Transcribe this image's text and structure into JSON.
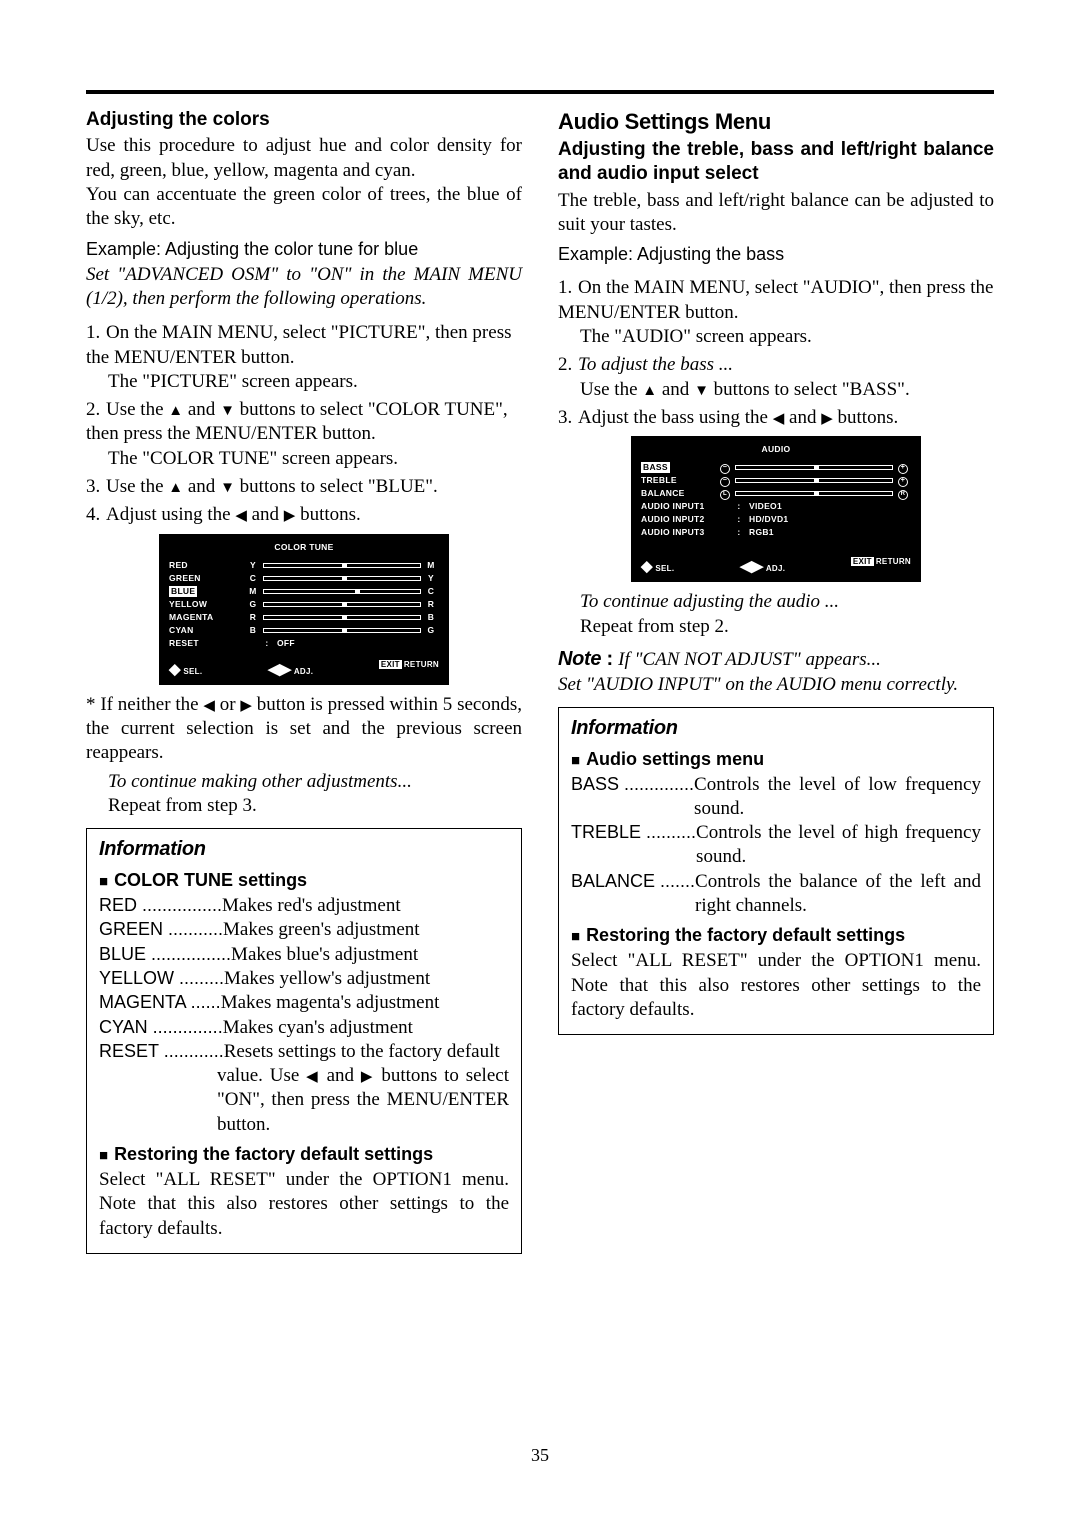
{
  "pagenum": "35",
  "left": {
    "h_colors": "Adjusting the colors",
    "p1": "Use this procedure to adjust hue and color density for red, green, blue, yellow, magenta and cyan.",
    "p2": "You can accentuate the green color of trees, the blue of the sky, etc.",
    "example": "Example: Adjusting the color tune for blue",
    "setline": "Set \"ADVANCED OSM\" to \"ON\" in the MAIN MENU (1/2), then perform the following operations.",
    "s1a": "On the MAIN MENU, select \"PICTURE\", then press the MENU/ENTER button.",
    "s1b": "The \"PICTURE\" screen appears.",
    "s2a": "Use the ",
    "s2b": " and ",
    "s2c": " buttons to select \"COLOR TUNE\", then press the MENU/ENTER button.",
    "s2d": "The \"COLOR TUNE\" screen appears.",
    "s3a": "Use the ",
    "s3b": " and ",
    "s3c": " buttons to select \"BLUE\".",
    "s4a": "Adjust using the ",
    "s4b": " and ",
    "s4c": " buttons.",
    "osm": {
      "title": "COLOR TUNE",
      "rows": [
        {
          "label": "RED",
          "l": "Y",
          "r": "M",
          "sel": false,
          "mark": 50
        },
        {
          "label": "GREEN",
          "l": "C",
          "r": "Y",
          "sel": false,
          "mark": 50
        },
        {
          "label": "BLUE",
          "l": "M",
          "r": "C",
          "sel": true,
          "mark": 58
        },
        {
          "label": "YELLOW",
          "l": "G",
          "r": "R",
          "sel": false,
          "mark": 50
        },
        {
          "label": "MAGENTA",
          "l": "R",
          "r": "B",
          "sel": false,
          "mark": 50
        },
        {
          "label": "CYAN",
          "l": "B",
          "r": "G",
          "sel": false,
          "mark": 50
        }
      ],
      "reset_label": "RESET",
      "reset_value": "OFF",
      "foot_sel": "SEL.",
      "foot_adj": "ADJ.",
      "foot_exit": "EXIT",
      "foot_return": "RETURN"
    },
    "star_note": "If neither the ",
    "star_note2": " or ",
    "star_note3": " button is pressed within 5 seconds, the current selection is set and the previous screen reappears.",
    "cont1": "To continue making other adjustments...",
    "cont2": "Repeat from step 3.",
    "info": {
      "title": "Information",
      "sub1": "COLOR TUNE settings",
      "defs": [
        {
          "term": "RED ................",
          "desc": "Makes red's adjustment"
        },
        {
          "term": "GREEN ...........",
          "desc": "Makes green's adjustment"
        },
        {
          "term": "BLUE ................",
          "desc": "Makes blue's adjustment"
        },
        {
          "term": "YELLOW .........",
          "desc": "Makes yellow's adjustment"
        },
        {
          "term": "MAGENTA ......",
          "desc": "Makes magenta's adjustment"
        },
        {
          "term": "CYAN ..............",
          "desc": "Makes cyan's adjustment"
        },
        {
          "term": "RESET ............",
          "desc": "Resets settings to the factory default value. Use "
        }
      ],
      "reset_tail1": " and ",
      "reset_tail2": " buttons to select \"ON\", then press the MENU/ENTER button.",
      "sub2": "Restoring the factory default settings",
      "restore": "Select \"ALL RESET\" under the OPTION1 menu. Note that this also restores other settings to the factory defaults."
    }
  },
  "right": {
    "title": "Audio Settings Menu",
    "h1": "Adjusting the treble, bass and left/right balance and audio input select",
    "p1": "The treble, bass and left/right balance can be adjusted to suit your tastes.",
    "example": "Example: Adjusting the bass",
    "s1a": "On the MAIN MENU, select \"AUDIO\", then press the MENU/ENTER button.",
    "s1b": "The \"AUDIO\" screen appears.",
    "s2a_it": "To adjust the bass ...",
    "s2b": "Use the ",
    "s2c": " and ",
    "s2d": " buttons to select \"BASS\".",
    "s3a": "Adjust the bass using the ",
    "s3b": " and ",
    "s3c": " buttons.",
    "osm": {
      "title": "AUDIO",
      "bars": [
        {
          "label": "BASS",
          "l": "−",
          "r": "+",
          "sel": true,
          "mark": 50
        },
        {
          "label": "TREBLE",
          "l": "−",
          "r": "+",
          "sel": false,
          "mark": 50
        },
        {
          "label": "BALANCE",
          "l": "L",
          "r": "R",
          "sel": false,
          "mark": 50
        }
      ],
      "vals": [
        {
          "label": "AUDIO INPUT1",
          "val": "VIDEO1"
        },
        {
          "label": "AUDIO INPUT2",
          "val": "HD/DVD1"
        },
        {
          "label": "AUDIO INPUT3",
          "val": "RGB1"
        }
      ],
      "foot_sel": "SEL.",
      "foot_adj": "ADJ.",
      "foot_exit": "EXIT",
      "foot_return": "RETURN"
    },
    "cont1": "To continue adjusting the audio ...",
    "cont2": "Repeat from step 2.",
    "note_label": "Note",
    "note_colon": " : ",
    "note1": "If \"CAN NOT ADJUST\" appears...",
    "note2": "Set \"AUDIO INPUT\" on the AUDIO menu correctly.",
    "info": {
      "title": "Information",
      "sub1": "Audio settings menu",
      "defs": [
        {
          "term": "BASS ..............",
          "desc": "Controls the level of low frequency sound."
        },
        {
          "term": "TREBLE ..........",
          "desc": "Controls the level of high frequency sound."
        },
        {
          "term": "BALANCE .......",
          "desc": "Controls the balance of the left and right channels."
        }
      ],
      "sub2": "Restoring the factory default settings",
      "restore": "Select \"ALL RESET\" under the OPTION1 menu. Note that this also restores other settings to the factory defaults."
    }
  }
}
